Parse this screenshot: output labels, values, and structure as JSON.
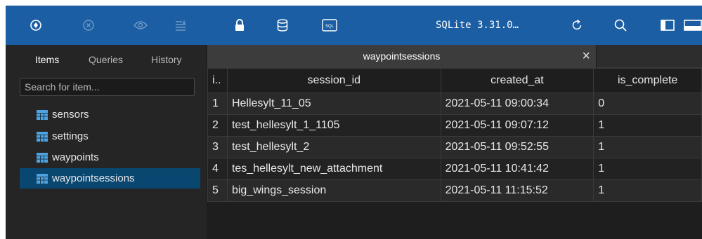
{
  "toolbar": {
    "icons": [
      "open-database-icon",
      "close-database-icon",
      "view-icon",
      "list-icon",
      "lock-icon",
      "database-icon",
      "sql-icon",
      "refresh-icon",
      "search-icon",
      "sidebar-toggle-icon",
      "panel-toggle-icon"
    ],
    "sql_badge": "SQL",
    "version_label": "SQLite 3.31.0…"
  },
  "sidebar": {
    "tabs": [
      {
        "label": "Items",
        "active": true
      },
      {
        "label": "Queries",
        "active": false
      },
      {
        "label": "History",
        "active": false
      }
    ],
    "search_placeholder": "Search for item...",
    "items": [
      {
        "label": "sensors",
        "icon": "table-icon",
        "selected": false
      },
      {
        "label": "settings",
        "icon": "table-icon",
        "selected": false
      },
      {
        "label": "waypoints",
        "icon": "table-icon",
        "selected": false
      },
      {
        "label": "waypointsessions",
        "icon": "table-icon",
        "selected": true
      }
    ]
  },
  "document_tab": {
    "title": "waypointsessions",
    "close_label": "×"
  },
  "table": {
    "columns": [
      "i..",
      "session_id",
      "created_at",
      "is_complete"
    ],
    "rows": [
      [
        "1",
        "Hellesylt_11_05",
        "2021-05-11 09:00:34",
        "0"
      ],
      [
        "2",
        "test_hellesylt_1_1105",
        "2021-05-11 09:07:12",
        "1"
      ],
      [
        "3",
        "test_hellesylt_2",
        "2021-05-11 09:52:55",
        "1"
      ],
      [
        "4",
        "tes_hellesylt_new_attachment",
        "2021-05-11 10:41:42",
        "1"
      ],
      [
        "5",
        "big_wings_session",
        "2021-05-11 11:15:52",
        "1"
      ]
    ]
  },
  "colors": {
    "toolbar": "#1c5ea3",
    "sidebar": "#252526",
    "selection": "#094771",
    "table_icon": "#4fa3e0"
  }
}
